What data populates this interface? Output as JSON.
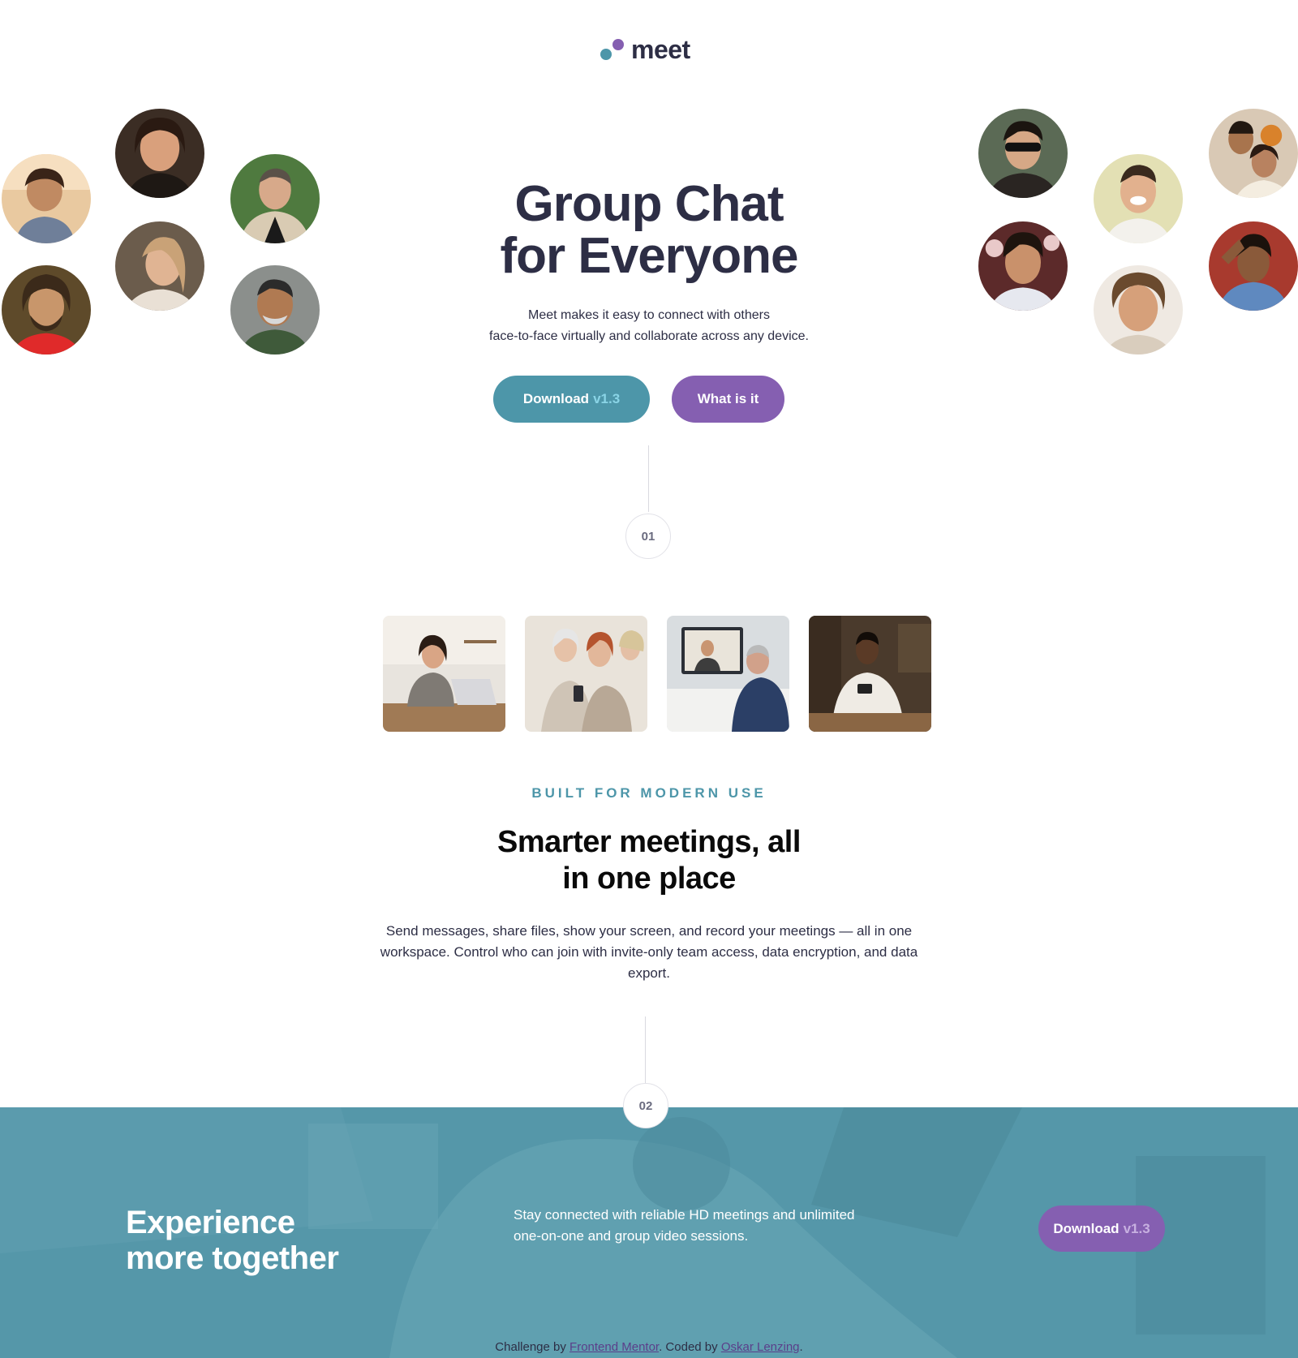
{
  "brand": {
    "name": "meet",
    "colors": {
      "teal": "#4d96a9",
      "purple": "#855fb1",
      "dark": "#2d2e45"
    }
  },
  "hero": {
    "title_line1": "Group Chat",
    "title_line2": "for Everyone",
    "text_line1": "Meet makes it easy to connect with others",
    "text_line2": "face-to-face virtually and collaborate across any device.",
    "download_label": "Download",
    "download_version": "v1.3",
    "what_label": "What is it"
  },
  "steps": {
    "one": "01",
    "two": "02"
  },
  "avatars_left": [
    "avatar",
    "avatar",
    "avatar",
    "avatar",
    "avatar",
    "avatar"
  ],
  "avatars_right": [
    "avatar",
    "avatar",
    "avatar",
    "avatar",
    "avatar",
    "avatar"
  ],
  "photos": [
    "woman-at-laptop",
    "women-with-phone",
    "video-call",
    "man-with-phone"
  ],
  "section": {
    "eyebrow": "BUILT FOR MODERN USE",
    "title_line1": "Smarter meetings, all",
    "title_line2": "in one place",
    "text": "Send messages, share files, show your screen, and record your meetings — all in one workspace. Control who can join with invite-only team access, data encryption, and data export."
  },
  "band": {
    "title_line1": "Experience",
    "title_line2": "more together",
    "text_line1": "Stay connected with reliable HD meetings and unlimited",
    "text_line2": "one-on-one and group video sessions.",
    "download_label": "Download",
    "download_version": "v1.3"
  },
  "footer": {
    "prefix": "Challenge by",
    "link1": "Frontend Mentor",
    "middle": ". Coded by",
    "link2": "Oskar Lenzing",
    "suffix": "."
  }
}
